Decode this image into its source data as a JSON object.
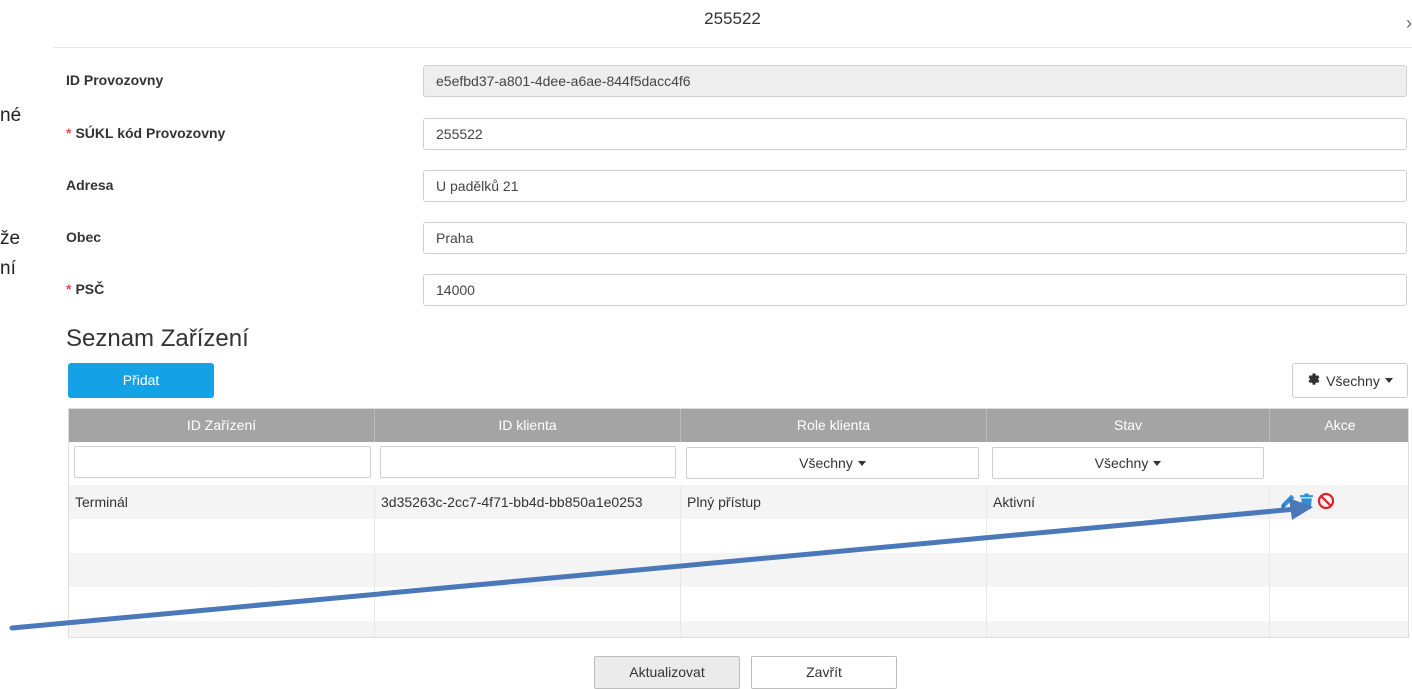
{
  "background_fragments": [
    "né",
    "že",
    "ní"
  ],
  "modal": {
    "title": "255522",
    "close_symbol": "›"
  },
  "form": {
    "fields": [
      {
        "label": "ID Provozovny",
        "required": false,
        "value": "e5efbd37-a801-4dee-a6ae-844f5dacc4f6",
        "disabled": true
      },
      {
        "label": "SÚKL kód Provozovny",
        "required": true,
        "value": "255522",
        "disabled": false
      },
      {
        "label": "Adresa",
        "required": false,
        "value": "U padělků 21",
        "disabled": false
      },
      {
        "label": "Obec",
        "required": false,
        "value": "Praha",
        "disabled": false
      },
      {
        "label": "PSČ",
        "required": true,
        "value": "14000",
        "disabled": false
      }
    ],
    "required_mark": "*"
  },
  "devices": {
    "title": "Seznam Zařízení",
    "add_label": "Přidat",
    "filter_label": "Všechny",
    "columns": [
      "ID Zařízení",
      "ID klienta",
      "Role klienta",
      "Stav",
      "Akce"
    ],
    "column_filters": {
      "role": "Všechny",
      "status": "Všechny"
    },
    "rows": [
      {
        "device_id": "Terminál",
        "client_id": "3d35263c-2cc7-4f71-bb4d-bb850a1e0253",
        "role": "Plný přístup",
        "status": "Aktivní"
      }
    ],
    "action_icons": [
      "pencil-icon",
      "trash-icon",
      "ban-icon"
    ]
  },
  "footer": {
    "update_label": "Aktualizovat",
    "close_label": "Zavřít"
  },
  "colors": {
    "primary": "#15a1e5",
    "header_gray": "#a4a4a4",
    "required": "#d9534f",
    "ban": "#e0202c",
    "arrow": "#4a78b8"
  }
}
